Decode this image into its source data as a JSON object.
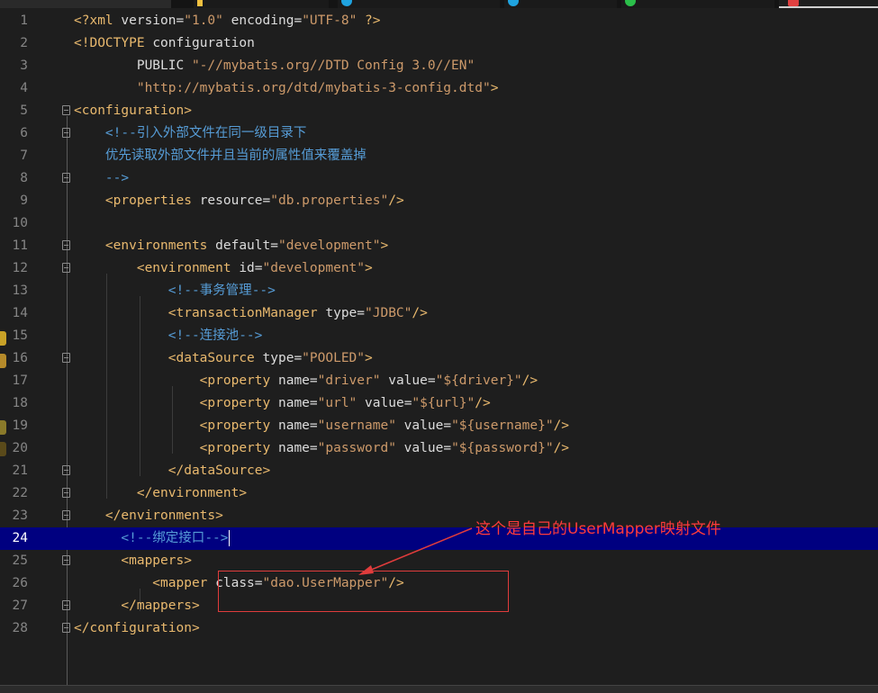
{
  "editor": {
    "language": "xml",
    "active_line": 24,
    "lines": [
      {
        "n": "1",
        "tokens": [
          [
            "t-tag",
            "<?xml "
          ],
          [
            "t-attr",
            "version"
          ],
          [
            "t-eq",
            "="
          ],
          [
            "t-str",
            "\"1.0\""
          ],
          [
            "t-attr",
            " encoding"
          ],
          [
            "t-eq",
            "="
          ],
          [
            "t-str",
            "\"UTF-8\""
          ],
          [
            "t-tag",
            " ?>"
          ]
        ]
      },
      {
        "n": "2",
        "tokens": [
          [
            "t-tag",
            "<!DOCTYPE "
          ],
          [
            "t-attr",
            "configuration"
          ]
        ]
      },
      {
        "n": "3",
        "tokens": [
          [
            "t-attr",
            "        PUBLIC "
          ],
          [
            "t-str",
            "\"-//mybatis.org//DTD Config 3.0//EN\""
          ]
        ]
      },
      {
        "n": "4",
        "tokens": [
          [
            "t-str",
            "        \"http://mybatis.org/dtd/mybatis-3-config.dtd\""
          ],
          [
            "t-tag",
            ">"
          ]
        ]
      },
      {
        "n": "5",
        "tokens": [
          [
            "t-tag",
            "<configuration>"
          ]
        ]
      },
      {
        "n": "6",
        "tokens": [
          [
            "t-com",
            "    <!--"
          ],
          [
            "t-com-c",
            "引入外部文件在同一级目录下"
          ]
        ]
      },
      {
        "n": "7",
        "tokens": [
          [
            "t-com-c",
            "    优先读取外部文件并且当前的属性值来覆盖掉"
          ]
        ]
      },
      {
        "n": "8",
        "tokens": [
          [
            "t-com",
            "    -->"
          ]
        ]
      },
      {
        "n": "9",
        "tokens": [
          [
            "t-tag",
            "    <properties "
          ],
          [
            "t-attr",
            "resource"
          ],
          [
            "t-eq",
            "="
          ],
          [
            "t-str",
            "\"db.properties\""
          ],
          [
            "t-tag",
            "/>"
          ]
        ]
      },
      {
        "n": "10",
        "tokens": []
      },
      {
        "n": "11",
        "tokens": [
          [
            "t-tag",
            "    <environments "
          ],
          [
            "t-attr",
            "default"
          ],
          [
            "t-eq",
            "="
          ],
          [
            "t-str",
            "\"development\""
          ],
          [
            "t-tag",
            ">"
          ]
        ]
      },
      {
        "n": "12",
        "tokens": [
          [
            "t-tag",
            "        <environment "
          ],
          [
            "t-attr",
            "id"
          ],
          [
            "t-eq",
            "="
          ],
          [
            "t-str",
            "\"development\""
          ],
          [
            "t-tag",
            ">"
          ]
        ]
      },
      {
        "n": "13",
        "tokens": [
          [
            "t-com",
            "            <!--"
          ],
          [
            "t-com-c",
            "事务管理"
          ],
          [
            "t-com",
            "-->"
          ]
        ]
      },
      {
        "n": "14",
        "tokens": [
          [
            "t-tag",
            "            <transactionManager "
          ],
          [
            "t-attr",
            "type"
          ],
          [
            "t-eq",
            "="
          ],
          [
            "t-str",
            "\"JDBC\""
          ],
          [
            "t-tag",
            "/>"
          ]
        ]
      },
      {
        "n": "15",
        "tokens": [
          [
            "t-com",
            "            <!--"
          ],
          [
            "t-com-c",
            "连接池"
          ],
          [
            "t-com",
            "-->"
          ]
        ]
      },
      {
        "n": "16",
        "tokens": [
          [
            "t-tag",
            "            <dataSource "
          ],
          [
            "t-attr",
            "type"
          ],
          [
            "t-eq",
            "="
          ],
          [
            "t-str",
            "\"POOLED\""
          ],
          [
            "t-tag",
            ">"
          ]
        ]
      },
      {
        "n": "17",
        "tokens": [
          [
            "t-tag",
            "                <property "
          ],
          [
            "t-attr",
            "name"
          ],
          [
            "t-eq",
            "="
          ],
          [
            "t-str",
            "\"driver\""
          ],
          [
            "t-attr",
            " value"
          ],
          [
            "t-eq",
            "="
          ],
          [
            "t-str",
            "\"${driver}\""
          ],
          [
            "t-tag",
            "/>"
          ]
        ]
      },
      {
        "n": "18",
        "tokens": [
          [
            "t-tag",
            "                <property "
          ],
          [
            "t-attr",
            "name"
          ],
          [
            "t-eq",
            "="
          ],
          [
            "t-str",
            "\"url\""
          ],
          [
            "t-attr",
            " value"
          ],
          [
            "t-eq",
            "="
          ],
          [
            "t-str",
            "\"${url}\""
          ],
          [
            "t-tag",
            "/>"
          ]
        ]
      },
      {
        "n": "19",
        "tokens": [
          [
            "t-tag",
            "                <property "
          ],
          [
            "t-attr",
            "name"
          ],
          [
            "t-eq",
            "="
          ],
          [
            "t-str",
            "\"username\""
          ],
          [
            "t-attr",
            " value"
          ],
          [
            "t-eq",
            "="
          ],
          [
            "t-str",
            "\"${username}\""
          ],
          [
            "t-tag",
            "/>"
          ]
        ]
      },
      {
        "n": "20",
        "tokens": [
          [
            "t-tag",
            "                <property "
          ],
          [
            "t-attr",
            "name"
          ],
          [
            "t-eq",
            "="
          ],
          [
            "t-str",
            "\"password\""
          ],
          [
            "t-attr",
            " value"
          ],
          [
            "t-eq",
            "="
          ],
          [
            "t-str",
            "\"${password}\""
          ],
          [
            "t-tag",
            "/>"
          ]
        ]
      },
      {
        "n": "21",
        "tokens": [
          [
            "t-tag",
            "            </dataSource>"
          ]
        ]
      },
      {
        "n": "22",
        "tokens": [
          [
            "t-tag",
            "        </environment>"
          ]
        ]
      },
      {
        "n": "23",
        "tokens": [
          [
            "t-tag",
            "    </environments>"
          ]
        ]
      },
      {
        "n": "24",
        "tokens": [
          [
            "t-com",
            "      <!--"
          ],
          [
            "t-com-c",
            "绑定接口"
          ],
          [
            "t-com",
            "-->"
          ]
        ]
      },
      {
        "n": "25",
        "tokens": [
          [
            "t-tag",
            "      <mappers>"
          ]
        ]
      },
      {
        "n": "26",
        "tokens": [
          [
            "t-tag",
            "          <mapper "
          ],
          [
            "t-attr",
            "class"
          ],
          [
            "t-eq",
            "="
          ],
          [
            "t-str",
            "\"dao.UserMapper\""
          ],
          [
            "t-tag",
            "/>"
          ]
        ]
      },
      {
        "n": "27",
        "tokens": [
          [
            "t-tag",
            "      </mappers>"
          ]
        ]
      },
      {
        "n": "28",
        "tokens": [
          [
            "t-tag",
            "</configuration>"
          ]
        ]
      }
    ]
  },
  "annotation": {
    "text": "这个是自己的UserMapper映射文件",
    "color": "#ff3b3b"
  },
  "colors": {
    "background": "#1e1e1e",
    "active_line": "#000080",
    "tag": "#e9b96e",
    "string": "#cd9a6a",
    "comment": "#569cd6"
  }
}
